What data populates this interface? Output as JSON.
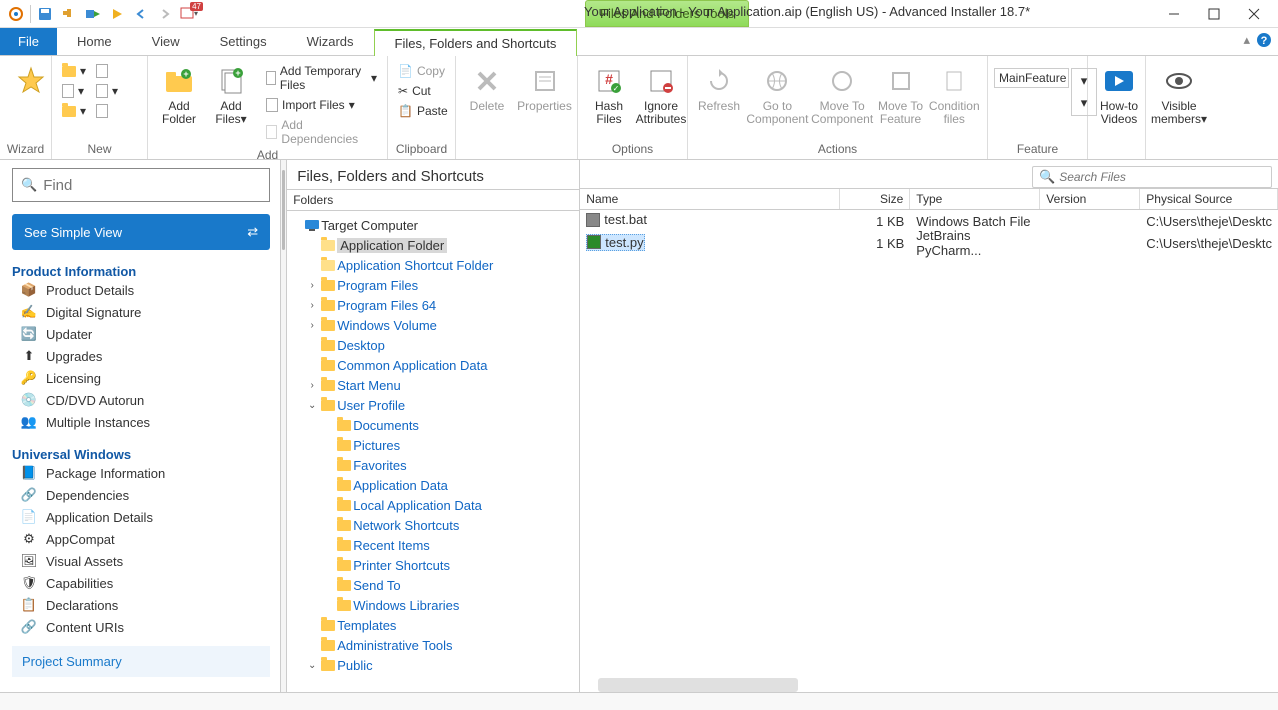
{
  "title": "Your Application - Your Application.aip (English US) - Advanced Installer 18.7*",
  "tools_tab": "Files And Folders Tools",
  "qat_badge": "47",
  "menu": {
    "file": "File",
    "home": "Home",
    "view": "View",
    "settings": "Settings",
    "wizards": "Wizards",
    "sub": "Files, Folders and Shortcuts"
  },
  "ribbon": {
    "wizard": {
      "label": "Wizard"
    },
    "new": {
      "label": "New"
    },
    "add": {
      "label": "Add",
      "addfolder": "Add\nFolder",
      "addfiles": "Add\nFiles",
      "add_temp": "Add Temporary Files",
      "import": "Import Files",
      "adddep": "Add Dependencies"
    },
    "clipboard": {
      "label": "Clipboard",
      "copy": "Copy",
      "cut": "Cut",
      "paste": "Paste"
    },
    "delete": "Delete",
    "properties": "Properties",
    "options": {
      "label": "Options",
      "hash": "Hash\nFiles",
      "ignore": "Ignore\nAttributes"
    },
    "actions": {
      "label": "Actions",
      "refresh": "Refresh",
      "goto": "Go to\nComponent",
      "movec": "Move To\nComponent",
      "movef": "Move To\nFeature",
      "cond": "Condition\nfiles"
    },
    "feature": {
      "label": "Feature",
      "value": "MainFeature"
    },
    "howto": "How-to\nVideos",
    "visible": "Visible\nmembers"
  },
  "left": {
    "find": "Find",
    "simple": "See Simple View",
    "h1": "Product Information",
    "nav1": [
      "Product Details",
      "Digital Signature",
      "Updater",
      "Upgrades",
      "Licensing",
      "CD/DVD Autorun",
      "Multiple Instances"
    ],
    "h2": "Universal Windows",
    "nav2": [
      "Package Information",
      "Dependencies",
      "Application Details",
      "AppCompat",
      "Visual Assets",
      "Capabilities",
      "Declarations",
      "Content URIs"
    ],
    "summary": "Project Summary"
  },
  "mid": {
    "title": "Files, Folders and Shortcuts",
    "hdr": "Folders",
    "tree": [
      {
        "l": "Target Computer",
        "ind": 0,
        "root": true,
        "icon": "pc"
      },
      {
        "l": "Application Folder",
        "ind": 1,
        "sel": true,
        "open": true
      },
      {
        "l": "Application Shortcut Folder",
        "ind": 1,
        "open": true
      },
      {
        "l": "Program Files",
        "ind": 1,
        "t": ">"
      },
      {
        "l": "Program Files 64",
        "ind": 1,
        "t": ">"
      },
      {
        "l": "Windows Volume",
        "ind": 1,
        "t": ">"
      },
      {
        "l": "Desktop",
        "ind": 1
      },
      {
        "l": "Common Application Data",
        "ind": 1
      },
      {
        "l": "Start Menu",
        "ind": 1,
        "t": ">"
      },
      {
        "l": "User Profile",
        "ind": 1,
        "t": "v"
      },
      {
        "l": "Documents",
        "ind": 2
      },
      {
        "l": "Pictures",
        "ind": 2
      },
      {
        "l": "Favorites",
        "ind": 2
      },
      {
        "l": "Application Data",
        "ind": 2
      },
      {
        "l": "Local Application Data",
        "ind": 2
      },
      {
        "l": "Network Shortcuts",
        "ind": 2
      },
      {
        "l": "Recent Items",
        "ind": 2
      },
      {
        "l": "Printer Shortcuts",
        "ind": 2
      },
      {
        "l": "Send To",
        "ind": 2
      },
      {
        "l": "Windows Libraries",
        "ind": 2
      },
      {
        "l": "Templates",
        "ind": 1
      },
      {
        "l": "Administrative Tools",
        "ind": 1
      },
      {
        "l": "Public",
        "ind": 1,
        "t": "v"
      }
    ]
  },
  "right": {
    "search": "Search Files",
    "cols": {
      "name": "Name",
      "size": "Size",
      "type": "Type",
      "version": "Version",
      "src": "Physical Source"
    },
    "files": [
      {
        "name": "test.bat",
        "size": "1 KB",
        "type": "Windows Batch File",
        "ver": "",
        "src": "C:\\Users\\theje\\Desktc",
        "sel": false,
        "color": "#888"
      },
      {
        "name": "test.py",
        "size": "1 KB",
        "type": "JetBrains PyCharm...",
        "ver": "",
        "src": "C:\\Users\\theje\\Desktc",
        "sel": true,
        "color": "#2a8a2a"
      }
    ]
  }
}
